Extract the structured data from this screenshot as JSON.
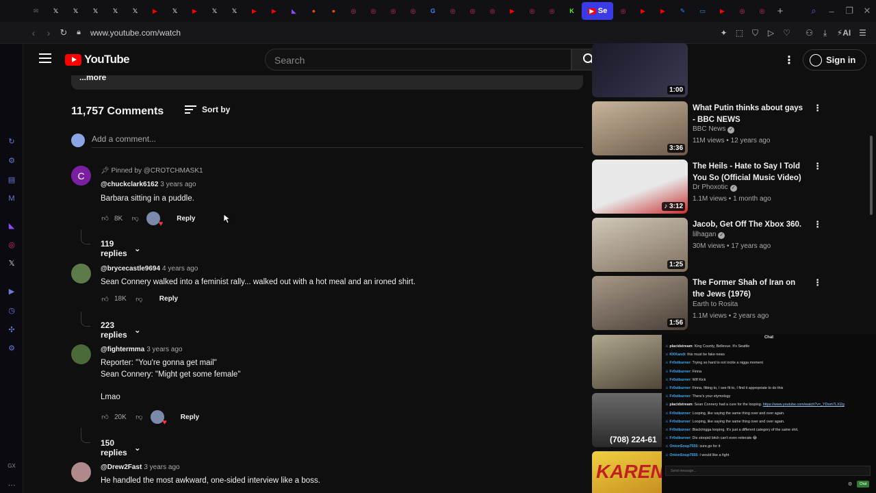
{
  "browser": {
    "tab_icons": [
      {
        "name": "mail-tab-icon",
        "glyph": "✉",
        "color": "#666"
      },
      {
        "name": "x-tab-icon",
        "glyph": "𝕏",
        "color": "#000"
      },
      {
        "name": "x-tab-icon",
        "glyph": "𝕏",
        "color": "#000"
      },
      {
        "name": "x-tab-icon",
        "glyph": "𝕏",
        "color": "#000"
      },
      {
        "name": "x-tab-icon",
        "glyph": "𝕏",
        "color": "#000"
      },
      {
        "name": "x-tab-icon",
        "glyph": "𝕏",
        "color": "#000"
      },
      {
        "name": "youtube-tab-icon",
        "glyph": "▶",
        "color": "#ff0000"
      },
      {
        "name": "x-tab-icon",
        "glyph": "𝕏",
        "color": "#000"
      },
      {
        "name": "youtube-tab-icon",
        "glyph": "▶",
        "color": "#ff0000"
      },
      {
        "name": "x-tab-icon",
        "glyph": "𝕏",
        "color": "#000"
      },
      {
        "name": "x-tab-icon",
        "glyph": "𝕏",
        "color": "#000"
      },
      {
        "name": "youtube-music-tab-icon",
        "glyph": "▶",
        "color": "#ff0000"
      },
      {
        "name": "youtube-music-tab-icon",
        "glyph": "▶",
        "color": "#ff0000"
      },
      {
        "name": "twitch-tab-icon",
        "glyph": "◣",
        "color": "#9146ff"
      },
      {
        "name": "reddit-tab-icon",
        "glyph": "●",
        "color": "#ff4500"
      },
      {
        "name": "reddit-tab-icon",
        "glyph": "●",
        "color": "#ff4500"
      },
      {
        "name": "instagram-tab-icon",
        "glyph": "◎",
        "color": "#e1306c"
      },
      {
        "name": "instagram-tab-icon",
        "glyph": "◎",
        "color": "#e1306c"
      },
      {
        "name": "instagram-tab-icon",
        "glyph": "◎",
        "color": "#e1306c"
      },
      {
        "name": "instagram-tab-icon",
        "glyph": "◎",
        "color": "#e1306c"
      },
      {
        "name": "google-tab-icon",
        "glyph": "G",
        "color": "#4285f4"
      },
      {
        "name": "instagram-tab-icon",
        "glyph": "◎",
        "color": "#e1306c"
      },
      {
        "name": "instagram-tab-icon",
        "glyph": "◎",
        "color": "#e1306c"
      },
      {
        "name": "instagram-tab-icon",
        "glyph": "◎",
        "color": "#e1306c"
      },
      {
        "name": "youtube-tab-icon",
        "glyph": "▶",
        "color": "#ff0000"
      },
      {
        "name": "instagram-tab-icon",
        "glyph": "◎",
        "color": "#e1306c"
      },
      {
        "name": "instagram-tab-icon",
        "glyph": "◎",
        "color": "#e1306c"
      },
      {
        "name": "kick-tab-icon",
        "glyph": "K",
        "color": "#53fc18"
      }
    ],
    "active_tab_label": "Se",
    "trailing_tab_icons": [
      {
        "name": "instagram-tab-icon",
        "glyph": "◎",
        "color": "#e1306c"
      },
      {
        "name": "youtube-tab-icon",
        "glyph": "▶",
        "color": "#ff0000"
      },
      {
        "name": "youtube-tab-icon",
        "glyph": "▶",
        "color": "#ff0000"
      },
      {
        "name": "edit-tab-icon",
        "glyph": "✎",
        "color": "#2f80ed"
      },
      {
        "name": "image-tab-icon",
        "glyph": "▭",
        "color": "#2ea0c8"
      },
      {
        "name": "youtube-tab-icon",
        "glyph": "▶",
        "color": "#ff0000"
      },
      {
        "name": "instagram-tab-icon",
        "glyph": "◎",
        "color": "#e1306c"
      },
      {
        "name": "instagram-tab-icon",
        "glyph": "◎",
        "color": "#e1306c"
      }
    ],
    "url": "www.youtube.com/watch",
    "ai_label": "AI"
  },
  "sidebar": {
    "gx_label": "GX"
  },
  "header": {
    "logo_text": "YouTube",
    "search_placeholder": "Search",
    "signin_label": "Sign in"
  },
  "description": {
    "more_label": "...more"
  },
  "comments": {
    "count_label": "11,757 Comments",
    "sort_label": "Sort by",
    "add_placeholder": "Add a comment...",
    "items": [
      {
        "avatar_letter": "C",
        "avatar_color": "#7b1fa2",
        "pinned": "Pinned by @CROTCHMASK1",
        "author": "@chuckclark6162",
        "time": "3 years ago",
        "lines": [
          "Barbara sitting in a puddle."
        ],
        "likes": "8K",
        "replies": "119 replies"
      },
      {
        "avatar_letter": "",
        "avatar_color": "#5d7a4a",
        "author": "@brycecastle9694",
        "time": "4 years ago",
        "lines": [
          "Sean Connery walked into a feminist rally... walked out with a hot meal and an ironed shirt."
        ],
        "likes": "18K",
        "replies": "223 replies"
      },
      {
        "avatar_letter": "",
        "avatar_color": "#4a6a3a",
        "author": "@fightermma",
        "time": "3 years ago",
        "lines": [
          "Reporter: \"You're gonna get mail\"",
          "Sean Connery: \"Might get some female\"",
          "",
          "Lmao"
        ],
        "likes": "20K",
        "replies": "150 replies"
      },
      {
        "avatar_letter": "",
        "avatar_color": "#b08a8a",
        "author": "@Drew2Fast",
        "time": "3 years ago",
        "lines": [
          "He handled the most awkward, one-sided interview like a boss."
        ]
      }
    ],
    "reply_label": "Reply"
  },
  "related": [
    {
      "title": "",
      "duration": "1:00",
      "thumb_colors": [
        "#1a1a2a",
        "#3a3a50"
      ]
    },
    {
      "title": "What Putin thinks about gays - BBC NEWS",
      "channel": "BBC News",
      "verified": true,
      "views": "11M views",
      "age": "12 years ago",
      "duration": "3:36",
      "thumb_colors": [
        "#c8b49a",
        "#6a5a4a"
      ]
    },
    {
      "title": "The Heils - Hate to Say I Told You So (Official Music Video)",
      "channel": "Dr Phoxotic",
      "verified": true,
      "views": "1.1M views",
      "age": "1 month ago",
      "duration": "3:12",
      "thumb_colors": [
        "#e8e8e8",
        "#c83030"
      ]
    },
    {
      "title": "Jacob, Get Off The Xbox 360.",
      "channel": "lilhagan",
      "verified": true,
      "views": "30M views",
      "age": "17 years ago",
      "duration": "1:25",
      "thumb_colors": [
        "#d0c8b8",
        "#807060"
      ]
    },
    {
      "title": "The Former Shah of Iran on the Jews (1976)",
      "channel": "Earth to Rosita",
      "verified": false,
      "views": "1.1M views",
      "age": "2 years ago",
      "duration": "1:56",
      "thumb_colors": [
        "#a89888",
        "#4a4038"
      ]
    }
  ],
  "extra_thumbs": [
    {
      "label": "",
      "colors": [
        "#b0a890",
        "#504838"
      ]
    },
    {
      "label": "(708) 224-61",
      "colors": [
        "#6a6a6a",
        "#2a2a2a"
      ]
    },
    {
      "label": "KAREN",
      "colors": [
        "#f0d040",
        "#c89020"
      ]
    }
  ],
  "chat": {
    "title": "Chat",
    "lines": [
      {
        "user": "placidstream",
        "white": true,
        "text": "King County, Bellevue. It's Seattle"
      },
      {
        "user": "KKKandi",
        "white": false,
        "text": "this must be fake news"
      },
      {
        "user": "Fr0stburner",
        "white": false,
        "text": "Trying so hard to not incite a nigga moment"
      },
      {
        "user": "Fr0stburner",
        "white": false,
        "text": "Finna"
      },
      {
        "user": "Fr0stburner",
        "white": false,
        "text": "Wtf Kick"
      },
      {
        "user": "Fr0stburner",
        "white": false,
        "text": "Finna, fitting to, I see fit to, I find it appropriate to do this"
      },
      {
        "user": "Fr0stburner",
        "white": false,
        "text": "There's your etymology"
      },
      {
        "user": "placidstream",
        "white": true,
        "text": "Sean Connery had a cure for the looping.",
        "link": "https://www.youtube.com/watch?v=_YDom7LXl2g"
      },
      {
        "user": "Fr0stburner",
        "white": false,
        "text": "Looping, like saying the same thing over and over again."
      },
      {
        "user": "Fr0stburner",
        "white": false,
        "text": "Looping, like saying the same thing over and over again."
      },
      {
        "user": "Fr0stburner",
        "white": false,
        "text": "Black/nigga looping. It's just a different category of the same shit."
      },
      {
        "user": "Fr0stburner",
        "white": false,
        "text": "Dis stoopid bitch can't even reiterate 😂"
      },
      {
        "user": "OnionSoup7555",
        "white": false,
        "text": "sure,go for it"
      },
      {
        "user": "OnionSoup7555",
        "white": false,
        "text": "I would like a fight"
      }
    ],
    "input_placeholder": "Send message...",
    "send_label": "Chat"
  }
}
